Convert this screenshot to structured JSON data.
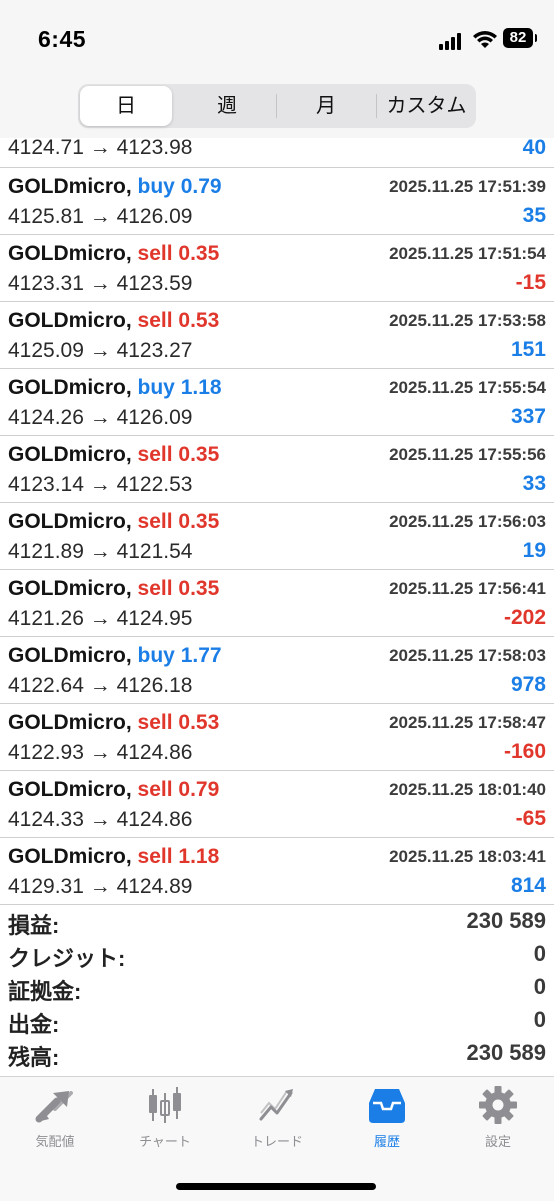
{
  "status_bar": {
    "time": "6:45",
    "battery": "82"
  },
  "segments": [
    {
      "label": "日",
      "active": true
    },
    {
      "label": "週",
      "active": false
    },
    {
      "label": "月",
      "active": false
    },
    {
      "label": "カスタム",
      "active": false
    }
  ],
  "first_row": {
    "price": "4124.71 → 4123.98",
    "profit": "40"
  },
  "trades": [
    {
      "symbol": "GOLDmicro,",
      "side": "buy",
      "volume": "0.79",
      "time": "2025.11.25 17:51:39",
      "price": "4125.81 → 4126.09",
      "profit": "35"
    },
    {
      "symbol": "GOLDmicro,",
      "side": "sell",
      "volume": "0.35",
      "time": "2025.11.25 17:51:54",
      "price": "4123.31 → 4123.59",
      "profit": "-15"
    },
    {
      "symbol": "GOLDmicro,",
      "side": "sell",
      "volume": "0.53",
      "time": "2025.11.25 17:53:58",
      "price": "4125.09 → 4123.27",
      "profit": "151"
    },
    {
      "symbol": "GOLDmicro,",
      "side": "buy",
      "volume": "1.18",
      "time": "2025.11.25 17:55:54",
      "price": "4124.26 → 4126.09",
      "profit": "337"
    },
    {
      "symbol": "GOLDmicro,",
      "side": "sell",
      "volume": "0.35",
      "time": "2025.11.25 17:55:56",
      "price": "4123.14 → 4122.53",
      "profit": "33"
    },
    {
      "symbol": "GOLDmicro,",
      "side": "sell",
      "volume": "0.35",
      "time": "2025.11.25 17:56:03",
      "price": "4121.89 → 4121.54",
      "profit": "19"
    },
    {
      "symbol": "GOLDmicro,",
      "side": "sell",
      "volume": "0.35",
      "time": "2025.11.25 17:56:41",
      "price": "4121.26 → 4124.95",
      "profit": "-202"
    },
    {
      "symbol": "GOLDmicro,",
      "side": "buy",
      "volume": "1.77",
      "time": "2025.11.25 17:58:03",
      "price": "4122.64 → 4126.18",
      "profit": "978"
    },
    {
      "symbol": "GOLDmicro,",
      "side": "sell",
      "volume": "0.53",
      "time": "2025.11.25 17:58:47",
      "price": "4122.93 → 4124.86",
      "profit": "-160"
    },
    {
      "symbol": "GOLDmicro,",
      "side": "sell",
      "volume": "0.79",
      "time": "2025.11.25 18:01:40",
      "price": "4124.33 → 4124.86",
      "profit": "-65"
    },
    {
      "symbol": "GOLDmicro,",
      "side": "sell",
      "volume": "1.18",
      "time": "2025.11.25 18:03:41",
      "price": "4129.31 → 4124.89",
      "profit": "814"
    }
  ],
  "summary": [
    {
      "label": "損益:",
      "value": "230 589"
    },
    {
      "label": "クレジット:",
      "value": "0"
    },
    {
      "label": "証拠金:",
      "value": "0"
    },
    {
      "label": "出金:",
      "value": "0"
    },
    {
      "label": "残高:",
      "value": "230 589"
    }
  ],
  "tabs": [
    {
      "label": "気配値",
      "icon": "quotes-arrows-icon",
      "active": false
    },
    {
      "label": "チャート",
      "icon": "candlestick-chart-icon",
      "active": false
    },
    {
      "label": "トレード",
      "icon": "trade-line-icon",
      "active": false
    },
    {
      "label": "履歴",
      "icon": "history-inbox-icon",
      "active": true
    },
    {
      "label": "設定",
      "icon": "gear-icon",
      "active": false
    }
  ],
  "colors": {
    "accent": "#1a7ee6",
    "negative": "#e0362b",
    "inactive": "#8e8e93"
  }
}
